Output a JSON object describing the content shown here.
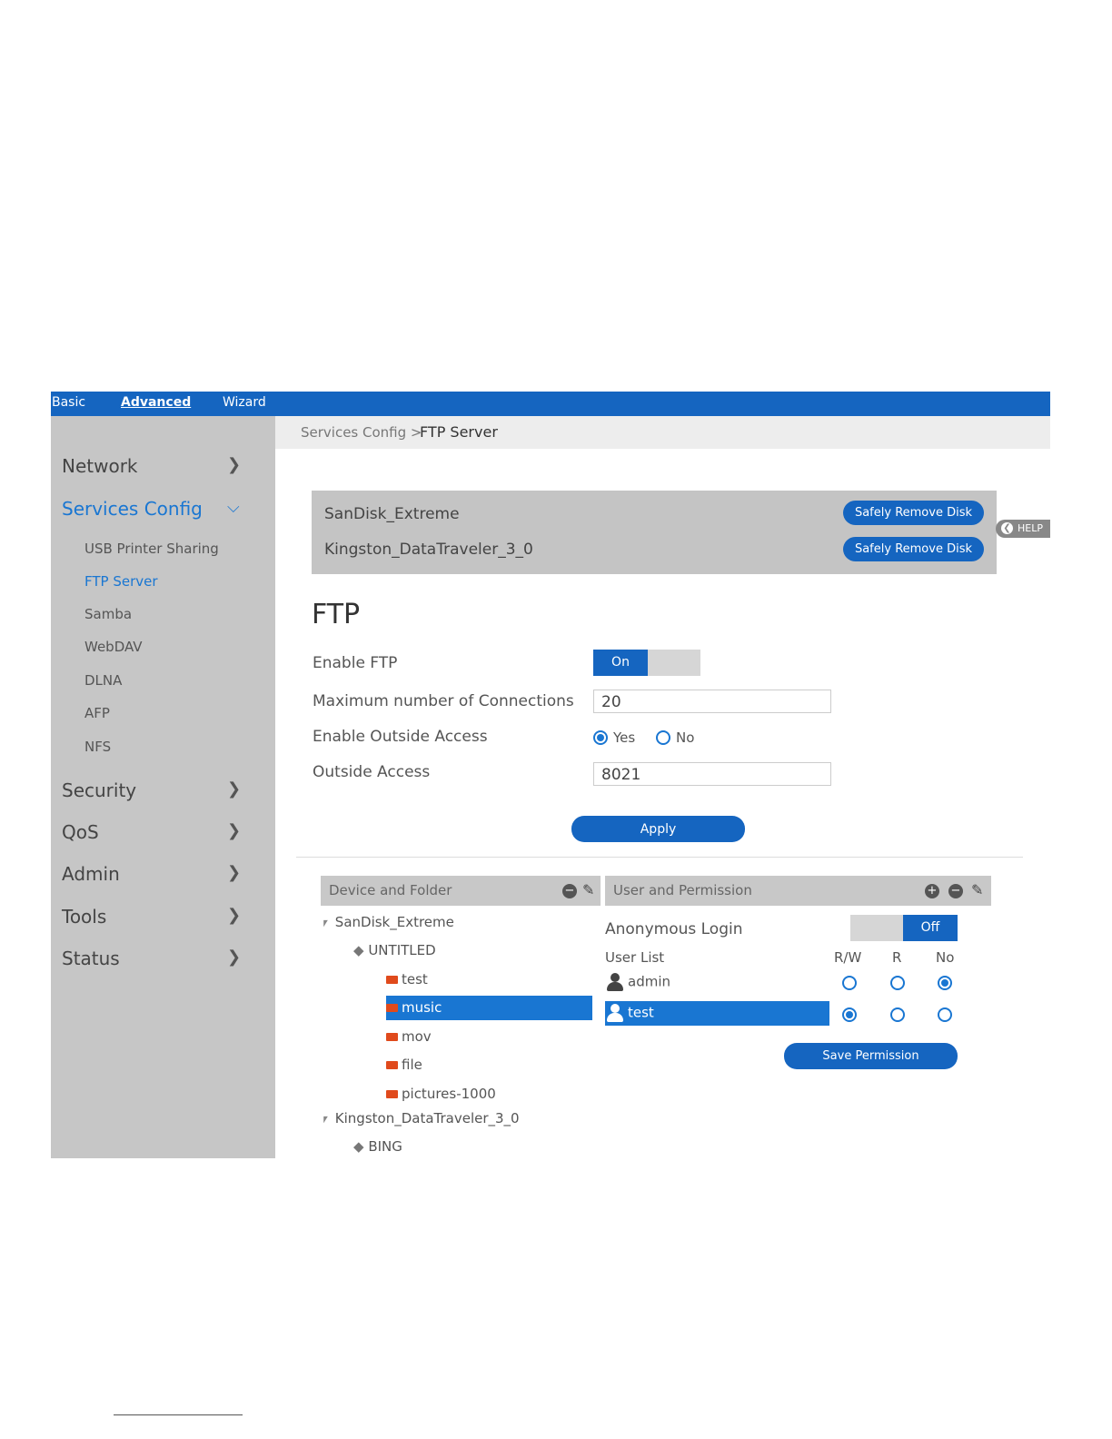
{
  "topnav": {
    "basic": "Basic",
    "advanced": "Advanced",
    "wizard": "Wizard"
  },
  "sidebar": {
    "network": "Network",
    "services_config": "Services Config",
    "sub": [
      "USB Printer Sharing",
      "FTP Server",
      "Samba",
      "WebDAV",
      "DLNA",
      "AFP",
      "NFS"
    ],
    "security": "Security",
    "qos": "QoS",
    "admin": "Admin",
    "tools": "Tools",
    "status": "Status"
  },
  "breadcrumb": {
    "parent": "Services Config >",
    "current": "FTP Server"
  },
  "disks": {
    "items": [
      "SanDisk_Extreme",
      "Kingston_DataTraveler_3_0"
    ],
    "remove_label": "Safely Remove Disk"
  },
  "help_label": "HELP",
  "ftp": {
    "title": "FTP",
    "enable_label": "Enable FTP",
    "enable_value": "On",
    "max_conn_label": "Maximum number of Connections",
    "max_conn_value": "20",
    "outside_access_enable_label": "Enable Outside Access",
    "yes": "Yes",
    "no": "No",
    "outside_access_label": "Outside Access",
    "outside_access_value": "8021",
    "apply_label": "Apply"
  },
  "device_panel": {
    "title": "Device and Folder",
    "tree": {
      "disk1": "SanDisk_Extreme",
      "volume1": "UNTITLED",
      "folders": [
        "test",
        "music",
        "mov",
        "file",
        "pictures-1000"
      ],
      "disk2": "Kingston_DataTraveler_3_0",
      "volume2": "BING"
    }
  },
  "user_panel": {
    "title": "User and Permission",
    "anonymous_label": "Anonymous Login",
    "anonymous_value": "Off",
    "user_list_label": "User List",
    "col_rw": "R/W",
    "col_r": "R",
    "col_no": "No",
    "users": [
      "admin",
      "test"
    ],
    "save_label": "Save Permission"
  }
}
